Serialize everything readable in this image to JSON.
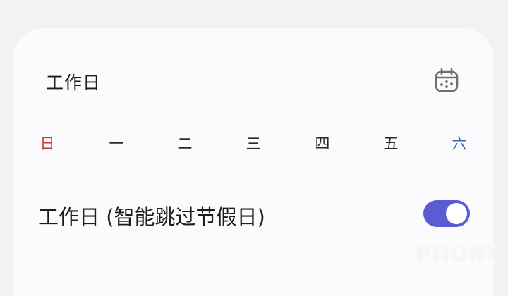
{
  "header": {
    "title": "工作日",
    "calendar_icon": "calendar-icon"
  },
  "weekdays": [
    {
      "label": "日",
      "color": "#c8382e"
    },
    {
      "label": "一",
      "color": "#2a2a2c"
    },
    {
      "label": "二",
      "color": "#2a2a2c"
    },
    {
      "label": "三",
      "color": "#2a2a2c"
    },
    {
      "label": "四",
      "color": "#2a2a2c"
    },
    {
      "label": "五",
      "color": "#2a2a2c"
    },
    {
      "label": "六",
      "color": "#2a66c4"
    }
  ],
  "workday_setting": {
    "label": "工作日 (智能跳过节假日)",
    "enabled": true,
    "accent": "#5b5bd6"
  },
  "watermark": {
    "text": "PHONE"
  }
}
